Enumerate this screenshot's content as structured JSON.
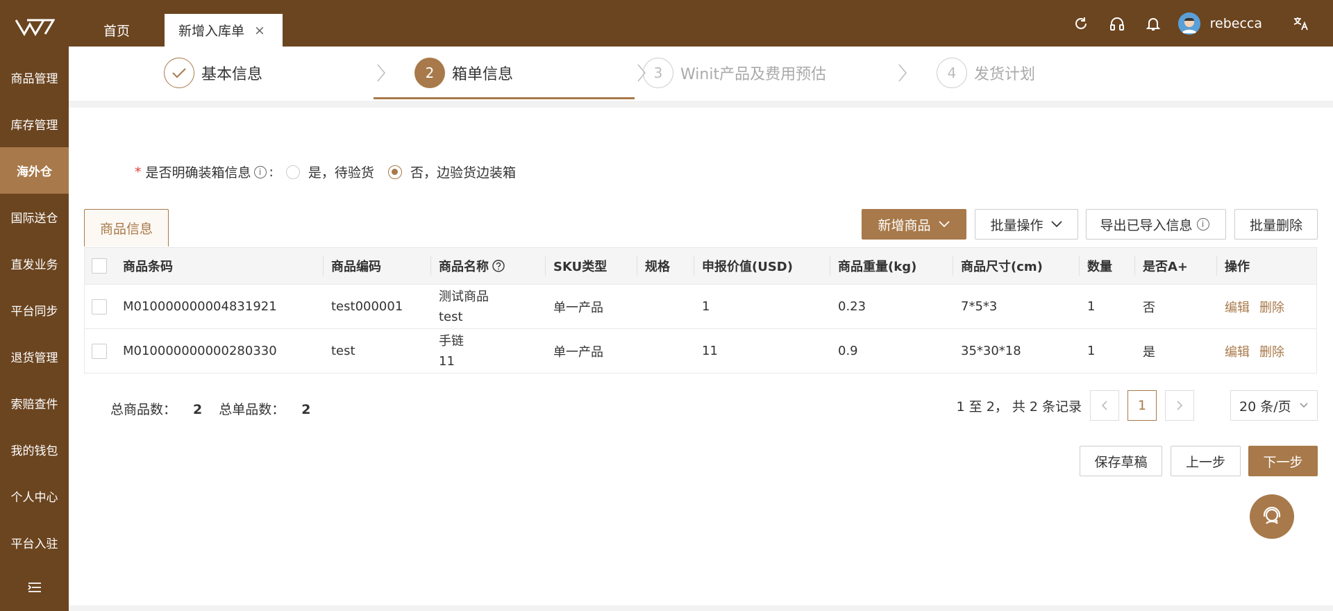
{
  "sidebar": {
    "logo": "logo",
    "items": [
      {
        "label": "商品管理"
      },
      {
        "label": "库存管理"
      },
      {
        "label": "海外仓"
      },
      {
        "label": "国际送仓"
      },
      {
        "label": "直发业务"
      },
      {
        "label": "平台同步"
      },
      {
        "label": "退货管理"
      },
      {
        "label": "索赔查件"
      },
      {
        "label": "我的钱包"
      },
      {
        "label": "个人中心"
      },
      {
        "label": "平台入驻"
      }
    ],
    "active_index": 2,
    "toggle_icon": "menu-collapse-icon"
  },
  "topbar": {
    "tabs": [
      {
        "label": "首页"
      },
      {
        "label": "新增入库单",
        "close": "×"
      }
    ],
    "icons": [
      "refresh-icon",
      "headset-icon",
      "bell-icon",
      "translate-icon"
    ],
    "username": "rebecca"
  },
  "steps": [
    {
      "label": "基本信息",
      "status": "done"
    },
    {
      "number": "2",
      "label": "箱单信息",
      "status": "current"
    },
    {
      "number": "3",
      "label": "Winit产品及费用预估",
      "status": "todo"
    },
    {
      "number": "4",
      "label": "发货计划",
      "status": "todo"
    }
  ],
  "form": {
    "required_mark": "*",
    "question": "是否明确装箱信息",
    "info_glyph": "i",
    "colon": ":",
    "options": [
      {
        "label": "是，待验货",
        "checked": false
      },
      {
        "label": "否，边验货边装箱",
        "checked": true
      }
    ]
  },
  "product_tab": {
    "label": "商品信息"
  },
  "toolbar": {
    "add_product": "新增商品",
    "batch_ops": "批量操作",
    "export_imported": "导出已导入信息",
    "batch_delete": "批量删除"
  },
  "table": {
    "headers": {
      "barcode": "商品条码",
      "code": "商品编码",
      "name": "商品名称",
      "sku_type": "SKU类型",
      "spec": "规格",
      "declared_value": "申报价值(USD)",
      "weight": "商品重量(kg)",
      "size": "商品尺寸(cm)",
      "qty": "数量",
      "a_plus": "是否A+",
      "ops": "操作"
    },
    "rows": [
      {
        "barcode": "M010000000004831921",
        "code": "test000001",
        "name_line1": "测试商品",
        "name_line2": "test",
        "sku_type": "单一产品",
        "spec": "",
        "declared_value": "1",
        "weight": "0.23",
        "size": "7*5*3",
        "qty": "1",
        "a_plus": "否",
        "edit": "编辑",
        "delete": "删除"
      },
      {
        "barcode": "M010000000000280330",
        "code": "test",
        "name_line1": "手链",
        "name_line2": "11",
        "sku_type": "单一产品",
        "spec": "",
        "declared_value": "11",
        "weight": "0.9",
        "size": "35*30*18",
        "qty": "1",
        "a_plus": "是",
        "edit": "编辑",
        "delete": "删除"
      }
    ]
  },
  "summary": {
    "total_products_label": "总商品数：",
    "total_products": "2",
    "total_single_label": "总单品数：",
    "total_single": "2"
  },
  "pagination": {
    "range_text": "1 至 2， 共 2 条记录",
    "current_page": "1",
    "page_size": "20 条/页"
  },
  "actions": {
    "save_draft": "保存草稿",
    "prev": "上一步",
    "next": "下一步"
  },
  "colors": {
    "brand_dark": "#6b4520",
    "accent": "#a8794a"
  }
}
